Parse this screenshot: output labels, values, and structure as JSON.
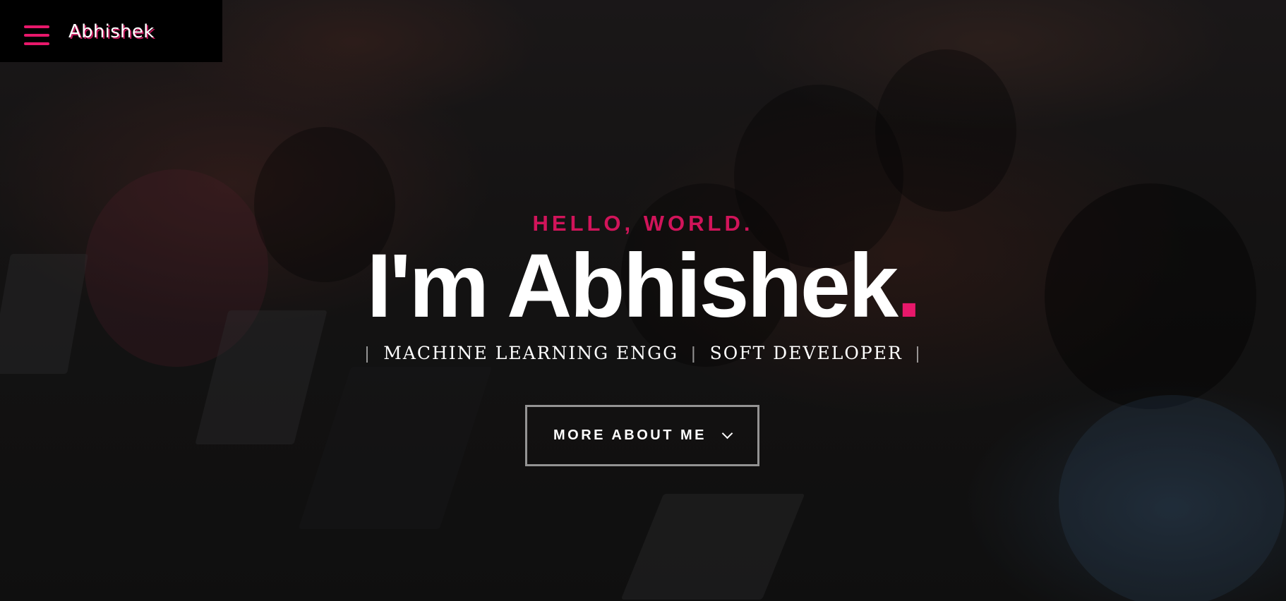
{
  "header": {
    "brand": "Abhishek",
    "menu_icon": "hamburger-menu-icon",
    "accent_color": "#e8186b"
  },
  "intro": {
    "greeting": "HELLO, WORLD.",
    "headline": "I'm Abhishek",
    "headline_dot": ".",
    "roles": [
      "MACHINE LEARNING ENGG",
      "SOFT DEVELOPER"
    ],
    "role_separator": "|",
    "cta_label": "MORE ABOUT ME",
    "cta_icon": "chevron-down-icon"
  }
}
